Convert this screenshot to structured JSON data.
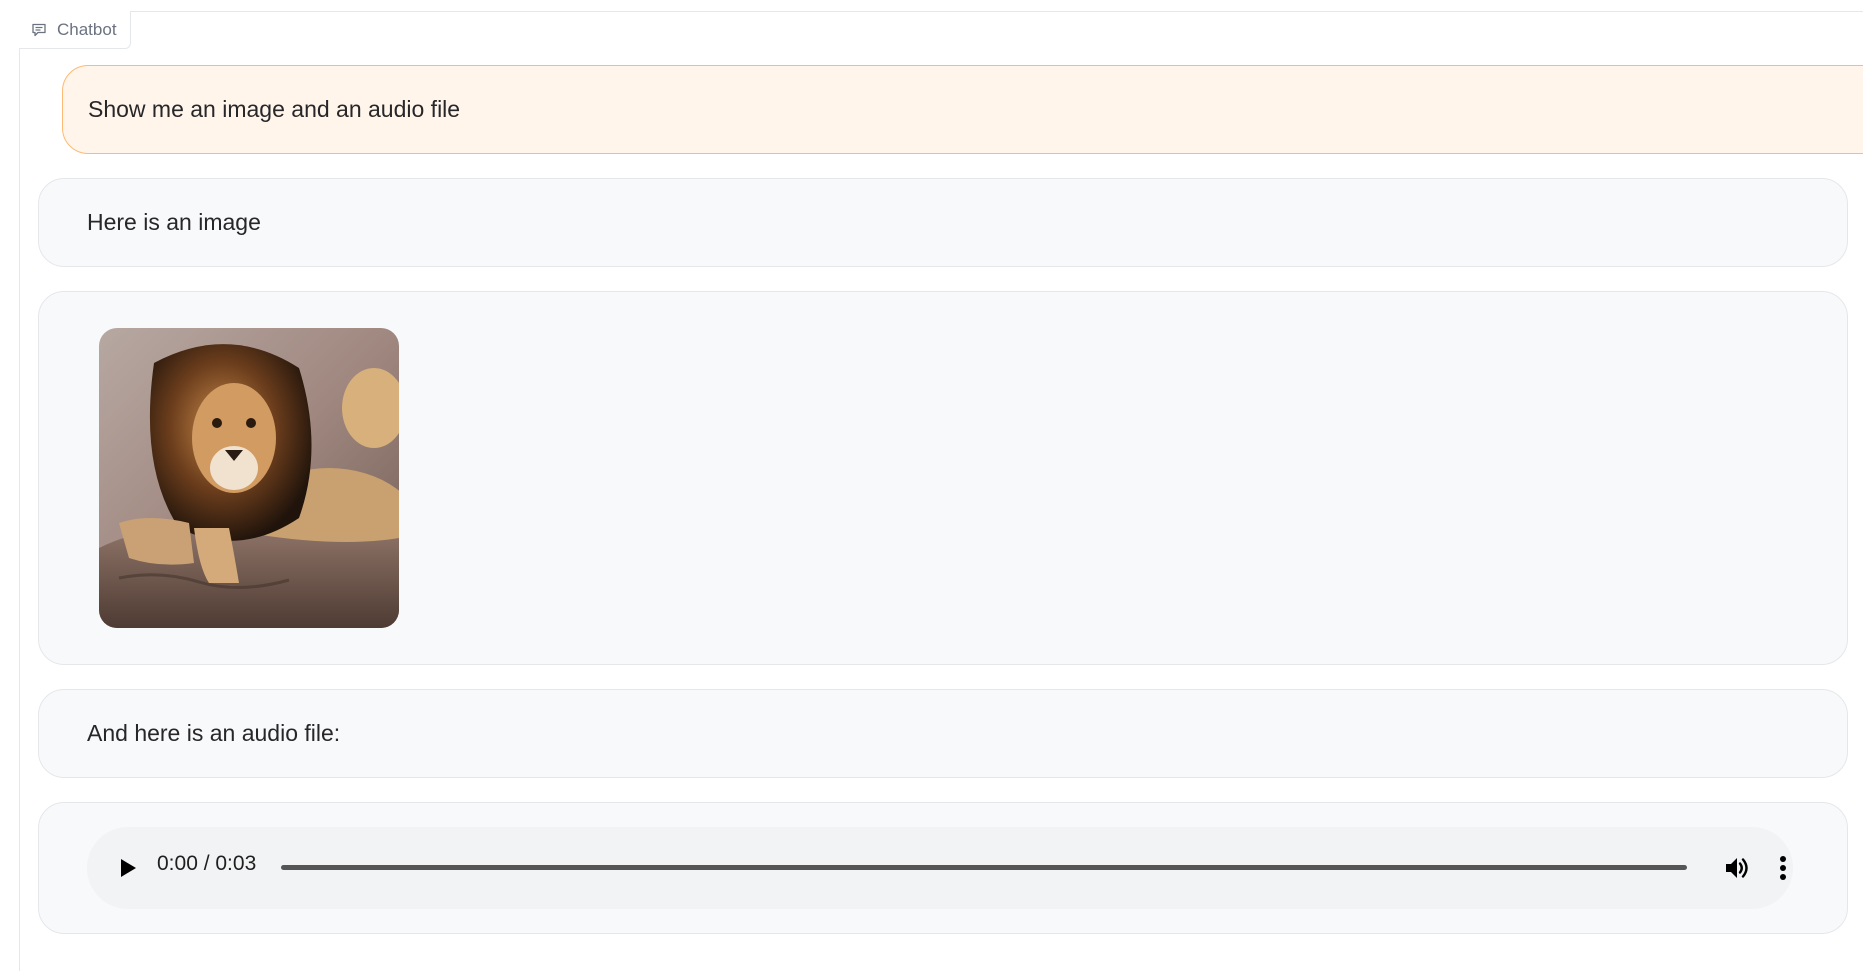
{
  "component": {
    "label": "Chatbot",
    "icon": "chat-bubble-icon"
  },
  "messages": {
    "user_1": "Show me an image and an audio file",
    "bot_1": "Here is an image",
    "bot_image": {
      "alt_subject": "lion-icon"
    },
    "bot_2": "And here is an audio file:"
  },
  "audio": {
    "time": "0:00 / 0:03",
    "progress": 0,
    "play_icon": "play-icon",
    "volume_icon": "volume-icon",
    "menu_icon": "more-vertical-icon"
  },
  "colors": {
    "user_bubble": "#fff5eb",
    "user_border": "#fdba74",
    "bot_bubble": "#f8f9fb",
    "border": "#e5e7eb"
  }
}
